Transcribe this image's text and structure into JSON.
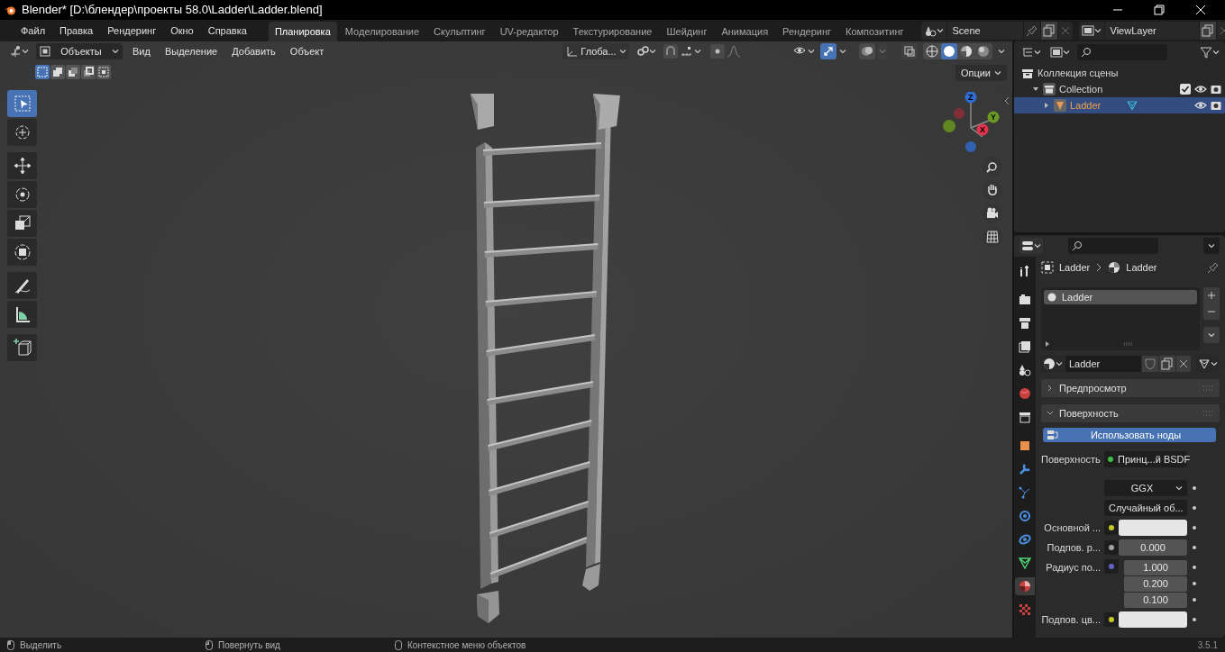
{
  "window": {
    "title": "Blender* [D:\\блендер\\проекты 58.0\\Ladder\\Ladder.blend]"
  },
  "menu": [
    "Файл",
    "Правка",
    "Рендеринг",
    "Окно",
    "Справка"
  ],
  "workspaces": [
    {
      "label": "Планировка",
      "selected": true
    },
    {
      "label": "Моделирование",
      "selected": false
    },
    {
      "label": "Скульптинг",
      "selected": false
    },
    {
      "label": "UV-редактор",
      "selected": false
    },
    {
      "label": "Текстурирование",
      "selected": false
    },
    {
      "label": "Шейдинг",
      "selected": false
    },
    {
      "label": "Анимация",
      "selected": false
    },
    {
      "label": "Рендеринг",
      "selected": false
    },
    {
      "label": "Композитинг",
      "selected": false
    }
  ],
  "scene": "Scene",
  "view_layer": "ViewLayer",
  "viewport": {
    "mode": "Объекты",
    "menus": [
      "Вид",
      "Выделение",
      "Добавить",
      "Объект"
    ],
    "orientation": "Глоба...",
    "options": "Опции",
    "gizmos_on": true,
    "select_modes": [
      {
        "selected": true
      },
      {
        "selected": false
      },
      {
        "selected": false
      },
      {
        "selected": false
      },
      {
        "selected": false
      }
    ],
    "shading": [
      {
        "kind": "wireframe",
        "selected": false
      },
      {
        "kind": "solid",
        "selected": true
      },
      {
        "kind": "material",
        "selected": false
      },
      {
        "kind": "rendered",
        "selected": false
      }
    ],
    "tools": [
      {
        "kind": "select",
        "selected": true
      },
      {
        "kind": "cursor",
        "selected": false
      },
      {
        "kind": "move",
        "selected": false
      },
      {
        "kind": "rotate",
        "selected": false
      },
      {
        "kind": "scale",
        "selected": false
      },
      {
        "kind": "transform",
        "selected": false
      },
      {
        "kind": "annotate",
        "selected": false
      },
      {
        "kind": "measure",
        "selected": false
      },
      {
        "kind": "add-cube",
        "selected": false
      }
    ],
    "gizmo_axes": [
      {
        "label": "Z",
        "color": "#2f6bd0"
      },
      {
        "label": "Y",
        "color": "#6a9a1f"
      },
      {
        "label": "X",
        "color": "#e1344a"
      }
    ]
  },
  "outliner": {
    "items": [
      {
        "kind": "scene_collection",
        "label": "Коллекция сцены",
        "selected": false,
        "children": [
          {
            "kind": "collection",
            "label": "Collection",
            "selected": false,
            "expanded": true,
            "checked": true,
            "children": [
              {
                "kind": "object",
                "label": "Ladder",
                "selected": true,
                "expanded": false
              }
            ]
          }
        ]
      }
    ]
  },
  "properties": {
    "tabs": [
      {
        "kind": "tool",
        "selected": false
      },
      {
        "kind": "render",
        "selected": false
      },
      {
        "kind": "output",
        "selected": false
      },
      {
        "kind": "view_layer",
        "selected": false
      },
      {
        "kind": "scene",
        "selected": false
      },
      {
        "kind": "world",
        "selected": false
      },
      {
        "kind": "collection",
        "selected": false
      },
      {
        "kind": "object",
        "selected": false
      },
      {
        "kind": "modifier",
        "selected": false
      },
      {
        "kind": "particles",
        "selected": false
      },
      {
        "kind": "physics",
        "selected": false
      },
      {
        "kind": "constraints",
        "selected": false
      },
      {
        "kind": "data",
        "selected": false
      },
      {
        "kind": "material",
        "selected": true
      },
      {
        "kind": "texture",
        "selected": false
      }
    ],
    "breadcrumb": [
      "Ladder",
      "Ladder"
    ],
    "slots": [
      {
        "label": "Ladder",
        "selected": true
      }
    ],
    "material": "Ladder",
    "panels": [
      {
        "label": "Предпросмотр",
        "expanded": false
      },
      {
        "label": "Поверхность",
        "expanded": true
      }
    ],
    "use_nodes": "Использовать ноды",
    "rows": [
      {
        "kind": "socket",
        "label": "Поверхность",
        "color": "#3fbf4a",
        "value": "Принц...й BSDF"
      },
      {
        "kind": "dropdown",
        "value": "GGX"
      },
      {
        "kind": "dropdown",
        "value": "Случайный об..."
      },
      {
        "kind": "color",
        "label": "Основной ...",
        "color": "#c7c729",
        "swatch": {
          "color": "#e6e6e6"
        }
      },
      {
        "kind": "number",
        "label": "Подпов. р...",
        "color": "#a1a1a1",
        "value": "0.000"
      },
      {
        "kind": "vector",
        "label": "Радиус по...",
        "color": "#6363c7",
        "values": [
          "1.000",
          "0.200",
          "0.100"
        ]
      },
      {
        "kind": "color",
        "label": "Подпов. цв...",
        "color": "#c7c729",
        "swatch": {
          "color": "#e6e6e6"
        }
      }
    ]
  },
  "status_bar": {
    "hints": [
      "Выделить",
      "Повернуть вид",
      "Контекстное меню объектов"
    ],
    "version": "3.5.1"
  }
}
